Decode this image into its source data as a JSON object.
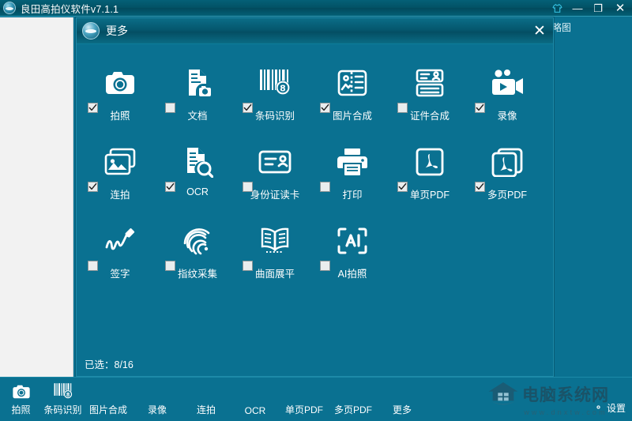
{
  "window": {
    "title": "良田高拍仪软件v7.1.1",
    "logo_icon": "app-logo-icon",
    "controls": {
      "skin": "shirt-icon",
      "minimize": "—",
      "maximize": "❐",
      "close": "✕"
    }
  },
  "right_panel": {
    "label": "略图"
  },
  "dialog": {
    "title": "更多",
    "logo_icon": "dialog-logo-icon",
    "close_label": "✕",
    "status": "已选：8/16",
    "rows": [
      [
        {
          "label": "拍照",
          "icon": "camera-icon",
          "checked": true
        },
        {
          "label": "文档",
          "icon": "document-scan-icon",
          "checked": false
        },
        {
          "label": "条码识别",
          "icon": "barcode-icon",
          "checked": true
        },
        {
          "label": "图片合成",
          "icon": "image-merge-icon",
          "checked": true
        },
        {
          "label": "证件合成",
          "icon": "id-merge-icon",
          "checked": false
        },
        {
          "label": "录像",
          "icon": "video-camera-icon",
          "checked": true
        }
      ],
      [
        {
          "label": "连拍",
          "icon": "burst-photo-icon",
          "checked": true
        },
        {
          "label": "OCR",
          "icon": "ocr-icon",
          "checked": true
        },
        {
          "label": "身份证读卡",
          "icon": "id-card-icon",
          "checked": false
        },
        {
          "label": "打印",
          "icon": "printer-icon",
          "checked": false
        },
        {
          "label": "单页PDF",
          "icon": "pdf-single-icon",
          "checked": true
        },
        {
          "label": "多页PDF",
          "icon": "pdf-multi-icon",
          "checked": true
        }
      ],
      [
        {
          "label": "签字",
          "icon": "signature-icon",
          "checked": false
        },
        {
          "label": "指纹采集",
          "icon": "fingerprint-icon",
          "checked": false
        },
        {
          "label": "曲面展平",
          "icon": "book-flatten-icon",
          "checked": false
        },
        {
          "label": "AI拍照",
          "icon": "ai-capture-icon",
          "checked": false
        }
      ]
    ]
  },
  "toolbar": {
    "items": [
      {
        "label": "拍照",
        "icon": "camera-icon",
        "has_icon": true
      },
      {
        "label": "条码识别",
        "icon": "barcode-icon",
        "has_icon": true
      },
      {
        "label": "图片合成",
        "icon": "",
        "has_icon": false
      },
      {
        "label": "录像",
        "icon": "",
        "has_icon": false
      },
      {
        "label": "连拍",
        "icon": "",
        "has_icon": false
      },
      {
        "label": "OCR",
        "icon": "",
        "has_icon": false
      },
      {
        "label": "单页PDF",
        "icon": "",
        "has_icon": false
      },
      {
        "label": "多页PDF",
        "icon": "",
        "has_icon": false
      },
      {
        "label": "更多",
        "icon": "",
        "has_icon": false
      }
    ],
    "settings": {
      "label": "设置",
      "icon": "gear-icon"
    }
  },
  "watermark": {
    "text": "电脑系统网",
    "url": "www.dnxtw.com",
    "logo_icon": "house-icon"
  },
  "colors": {
    "body_teal": "#0a7191",
    "titlebar_dark": "#04566b",
    "accent_white": "#ffffff",
    "panel_white": "#f2f2f2",
    "skin_icon": "#36c3e4"
  }
}
